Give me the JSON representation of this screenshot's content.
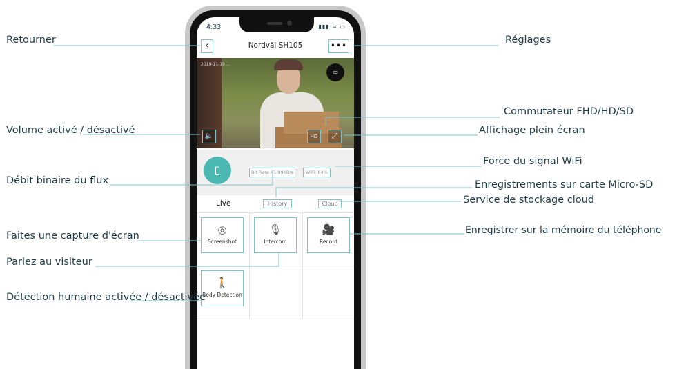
{
  "phone": {
    "status_time": "4:33",
    "status_icons": "▮▮▮ ≈ ▭",
    "nav_title": "Nordväl SH105",
    "back_glyph": "‹",
    "more_glyph": "•••",
    "timestamp": "2019-11-19 ...",
    "battery_glyph": "▭",
    "volume_glyph": "🔈",
    "hd_label": "HD",
    "fullscreen_glyph": "⤢",
    "device_glyph": "▯",
    "bitrate": "Bit Rate:41.99KB/s",
    "wifi": "WiFi: 84%",
    "tabs": {
      "live": "Live",
      "history": "History",
      "cloud": "Cloud"
    },
    "controls": [
      {
        "label": "Screenshot",
        "icon": "◎"
      },
      {
        "label": "Intercom",
        "icon": "🎙"
      },
      {
        "label": "Record",
        "icon": "🎥"
      },
      {
        "label": "Body Detection",
        "icon": "🚶"
      }
    ]
  },
  "callouts": {
    "retourner": "Retourner",
    "reglages": "Réglages",
    "commutateur": "Commutateur FHD/HD/SD",
    "volume": "Volume activé / désactivé",
    "plein_ecran": "Affichage plein écran",
    "wifi": "Force du signal WiFi",
    "debit": "Débit binaire du flux",
    "micro_sd": "Enregistrements sur carte Micro-SD",
    "cloud": "Service de stockage cloud",
    "capture": "Faites une capture d'écran",
    "memoire": "Enregistrer sur la mémoire du téléphone",
    "parlez": "Parlez au visiteur",
    "detection": "Détection humaine activée / désactivée"
  },
  "colors": {
    "accent": "#7fc3c9",
    "device_icon": "#4ab7b0",
    "text": "#1f3b45"
  }
}
